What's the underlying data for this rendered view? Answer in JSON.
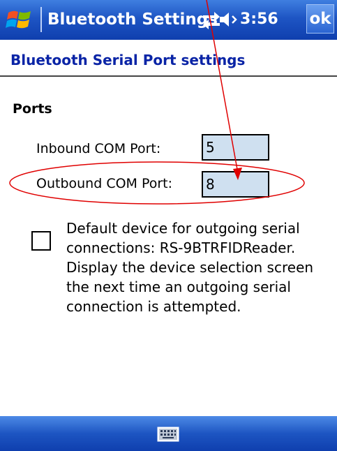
{
  "titlebar": {
    "title": "Bluetooth Settings",
    "time": "3:56",
    "ok_label": "ok",
    "icons": [
      "windows-start-icon",
      "connectivity-icon",
      "volume-icon"
    ]
  },
  "page": {
    "heading": "Bluetooth Serial Port settings",
    "section": "Ports"
  },
  "fields": {
    "inbound": {
      "label": "Inbound COM Port:",
      "value": "5"
    },
    "outbound": {
      "label": "Outbound COM Port:",
      "value": "8"
    }
  },
  "default_device": {
    "checked": false,
    "text": "Default device for outgoing serial connections: RS-9BTRFIDReader. Display the device selection screen the next time an outgoing serial connection is attempted."
  },
  "bottombar": {
    "icon": "keyboard-icon"
  },
  "annotation": {
    "colors": {
      "arrow": "#e00000",
      "ellipse": "#e00000"
    }
  }
}
